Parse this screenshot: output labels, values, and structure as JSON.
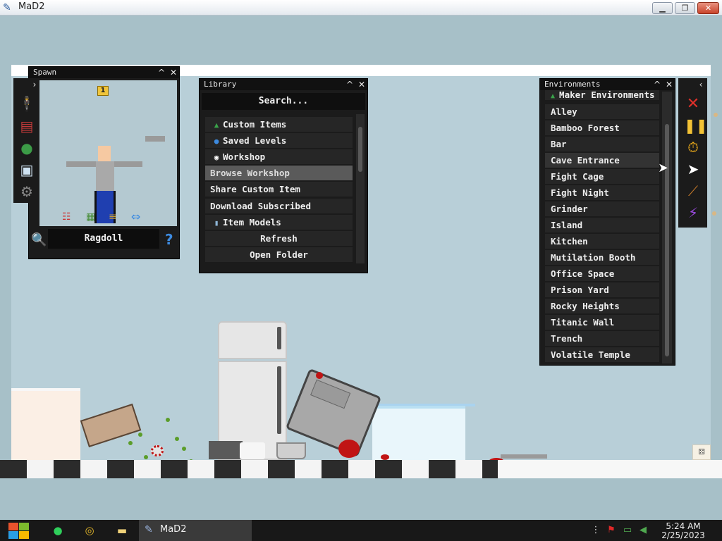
{
  "window": {
    "title": "MaD2",
    "minimize": "▁",
    "maximize": "❐",
    "close": "✕"
  },
  "spawn": {
    "title": "Spawn",
    "collapse": "^",
    "close": "✕",
    "toggle": "›",
    "count": "1",
    "selected": "Ragdoll",
    "help": "?"
  },
  "library": {
    "title": "Library",
    "collapse": "^",
    "close": "✕",
    "search": "Search...",
    "items": [
      {
        "label": "Custom Items",
        "icon": "▲"
      },
      {
        "label": "Saved Levels",
        "icon": "●"
      },
      {
        "label": "Workshop",
        "icon": "◉"
      },
      {
        "label": "Browse Workshop",
        "icon": ""
      },
      {
        "label": "Share Custom Item",
        "icon": ""
      },
      {
        "label": "Download Subscribed",
        "icon": ""
      },
      {
        "label": "Item Models",
        "icon": "▮"
      },
      {
        "label": "Refresh",
        "icon": ""
      },
      {
        "label": "Open Folder",
        "icon": ""
      }
    ]
  },
  "environments": {
    "title": "Environments",
    "collapse": "^",
    "close": "✕",
    "header_item": "Maker Environments",
    "items": [
      "Alley",
      "Bamboo Forest",
      "Bar",
      "Cave Entrance",
      "Fight Cage",
      "Fight Night",
      "Grinder",
      "Island",
      "Kitchen",
      "Mutilation Booth",
      "Office Space",
      "Prison Yard",
      "Rocky Heights",
      "Titanic Wall",
      "Trench",
      "Volatile Temple"
    ]
  },
  "tools": {
    "toggle": "‹"
  },
  "taskbar": {
    "task_label": "MaD2",
    "time": "5:24 AM",
    "date": "2/25/2023"
  },
  "colors": {
    "panel": "#1b1b1b",
    "row": "#262626",
    "accent_blue": "#3d8be0",
    "sky": "#b8cfd8"
  }
}
